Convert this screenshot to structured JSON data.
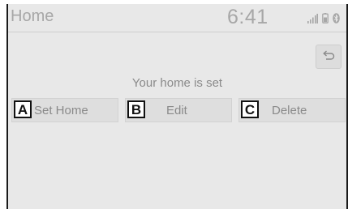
{
  "header": {
    "title": "Home",
    "clock": "6:41",
    "status_icons": [
      "signal-icon",
      "phone-battery-icon",
      "bluetooth-icon"
    ]
  },
  "back_button": {
    "icon": "back-arrow-icon"
  },
  "message": "Your home is set",
  "options": [
    {
      "callout": "A",
      "label": "Set Home"
    },
    {
      "callout": "B",
      "label": "Edit"
    },
    {
      "callout": "C",
      "label": "Delete"
    }
  ],
  "colors": {
    "screen_bg": "#e8e8e8",
    "button_bg": "#dedede",
    "text": "#8a8a8a",
    "header_text": "#a7a7a7",
    "callout_border": "#111111"
  }
}
